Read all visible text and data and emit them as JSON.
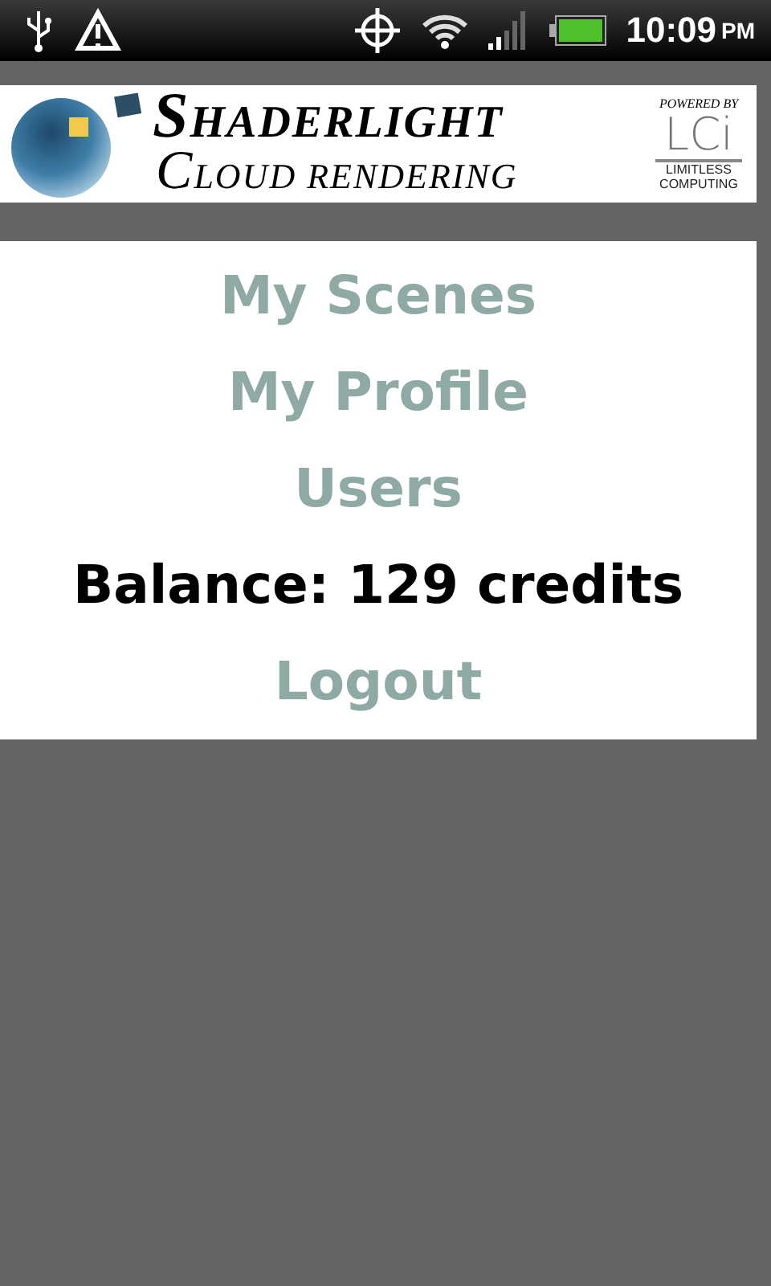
{
  "status_bar": {
    "time": "10:09",
    "period": "PM"
  },
  "banner": {
    "title": "SHADERLIGHT",
    "subtitle": "CLOUD RENDERING",
    "powered_by": "POWERED BY",
    "partner_logo": "LCi",
    "partner_line_1": "LIMITLESS",
    "partner_line_2": "COMPUTING"
  },
  "menu": [
    {
      "kind": "link",
      "label": "My Scenes"
    },
    {
      "kind": "link",
      "label": "My Profile"
    },
    {
      "kind": "link",
      "label": "Users"
    },
    {
      "kind": "text",
      "label": "Balance: 129 credits"
    },
    {
      "kind": "link",
      "label": "Logout"
    }
  ]
}
